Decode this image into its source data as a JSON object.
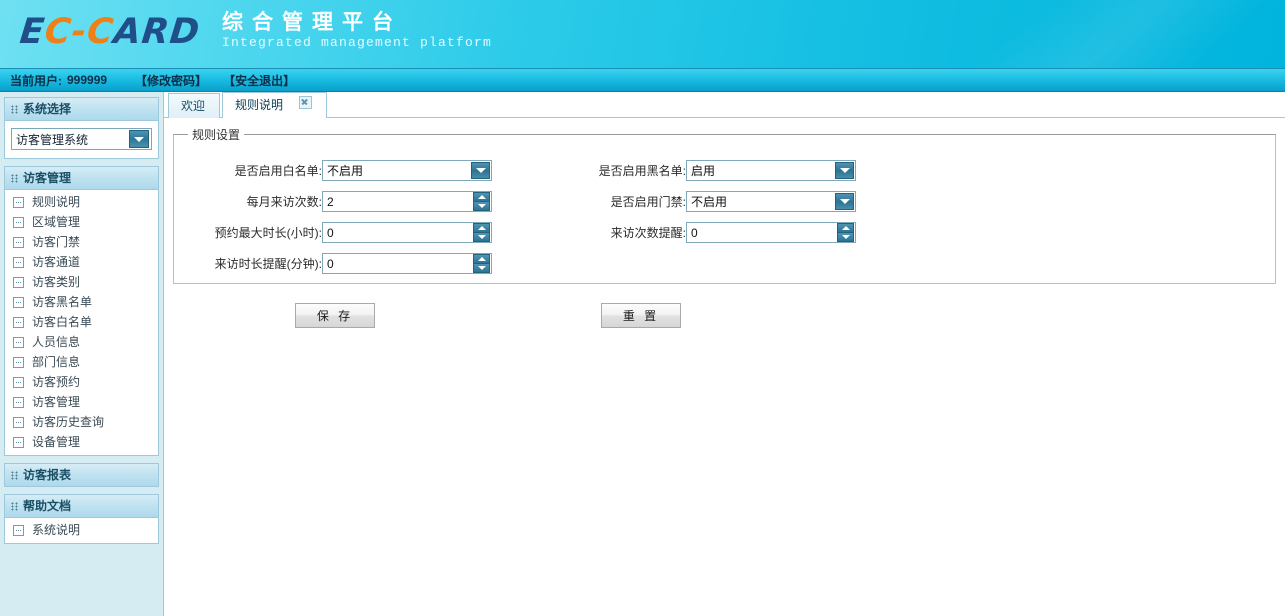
{
  "header": {
    "logo": {
      "part1": "E",
      "part2": "C-C",
      "part3": "ARD"
    },
    "title_cn": "综合管理平台",
    "title_en": "Integrated management platform"
  },
  "userbar": {
    "current_user_label": "当前用户:",
    "current_user": "999999",
    "change_password": "【修改密码】",
    "logout": "【安全退出】"
  },
  "sidebar": {
    "system_panel": {
      "title": "系统选择",
      "selected": "访客管理系统"
    },
    "visitor_panel": {
      "title": "访客管理",
      "items": [
        {
          "label": "规则说明"
        },
        {
          "label": "区域管理"
        },
        {
          "label": "访客门禁"
        },
        {
          "label": "访客通道"
        },
        {
          "label": "访客类别"
        },
        {
          "label": "访客黑名单"
        },
        {
          "label": "访客白名单"
        },
        {
          "label": "人员信息"
        },
        {
          "label": "部门信息"
        },
        {
          "label": "访客预约"
        },
        {
          "label": "访客管理"
        },
        {
          "label": "访客历史查询"
        },
        {
          "label": "设备管理"
        }
      ]
    },
    "report_panel": {
      "title": "访客报表"
    },
    "help_panel": {
      "title": "帮助文档",
      "items": [
        {
          "label": "系统说明"
        }
      ]
    }
  },
  "tabs": [
    {
      "label": "欢迎",
      "active": false,
      "closable": false
    },
    {
      "label": "规则说明",
      "active": true,
      "closable": true
    }
  ],
  "form": {
    "legend": "规则设置",
    "rows": [
      {
        "left": {
          "label": "是否启用白名单:",
          "value": "不启用",
          "type": "select"
        },
        "right": {
          "label": "是否启用黑名单:",
          "value": "启用",
          "type": "select"
        }
      },
      {
        "left": {
          "label": "每月来访次数:",
          "value": "2",
          "type": "spinner"
        },
        "right": {
          "label": "是否启用门禁:",
          "value": "不启用",
          "type": "select"
        }
      },
      {
        "left": {
          "label": "预约最大时长(小时):",
          "value": "0",
          "type": "spinner"
        },
        "right": {
          "label": "来访次数提醒:",
          "value": "0",
          "type": "spinner"
        }
      },
      {
        "left": {
          "label": "来访时长提醒(分钟):",
          "value": "0",
          "type": "spinner"
        },
        "right": null
      }
    ],
    "save_label": "保 存",
    "reset_label": "重 置"
  },
  "colors": {
    "header_cyan": "#14bfe2",
    "logo_blue": "#1f4e88",
    "logo_orange": "#ef8018",
    "sidebar_bg": "#d4ecf2",
    "panel_border": "#9ec9dd",
    "control_border": "#7fa8bb"
  }
}
